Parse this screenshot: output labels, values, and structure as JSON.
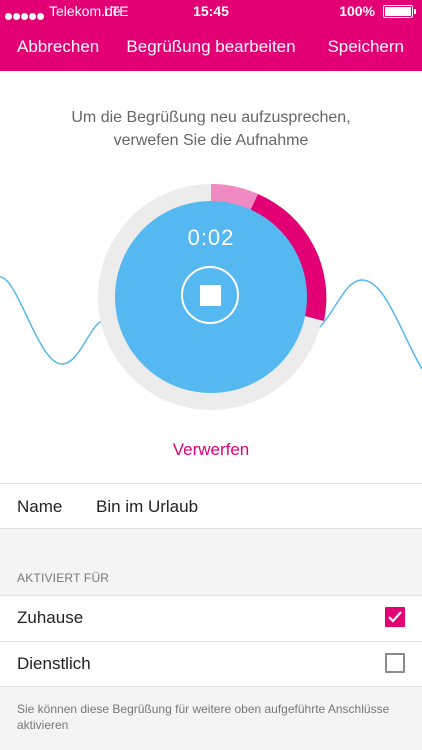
{
  "status_bar": {
    "carrier": "Telekom.de",
    "network": "LTE",
    "time": "15:45",
    "battery": "100%"
  },
  "nav": {
    "cancel_label": "Abbrechen",
    "title": "Begrüßung bearbeiten",
    "save_label": "Speichern"
  },
  "recorder": {
    "instruction_line1": "Um die Begrüßung neu aufzusprechen,",
    "instruction_line2": "verwefen Sie die Aufnahme",
    "timer": "0:02",
    "discard_label": "Verwerfen"
  },
  "name_field": {
    "label": "Name",
    "value": "Bin im Urlaub"
  },
  "activation": {
    "header": "AKTIVIERT FÜR",
    "options": [
      {
        "label": "Zuhause",
        "checked": true
      },
      {
        "label": "Dienstlich",
        "checked": false
      }
    ],
    "note": "Sie können diese Begrüßung für weitere oben aufgeführte Anschlüsse aktivieren"
  },
  "colors": {
    "brand": "#e20074",
    "recorder_fill": "#55b8f1",
    "progress_light": "#f08ac2"
  }
}
